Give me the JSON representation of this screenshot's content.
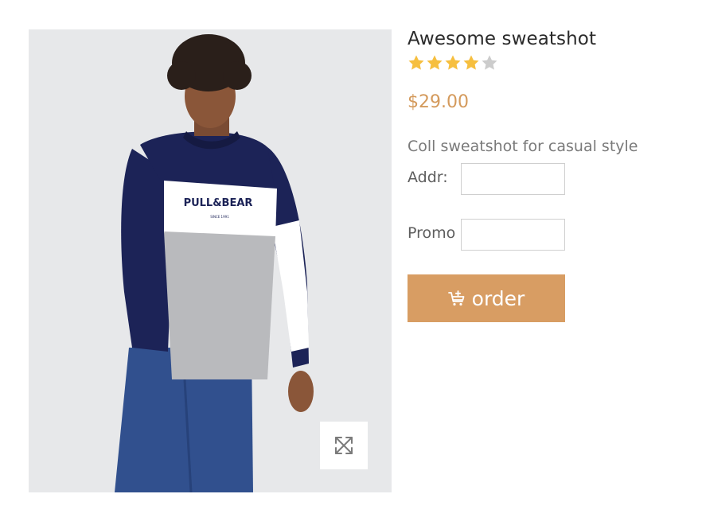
{
  "product": {
    "title": "Awesome sweatshot",
    "rating": {
      "value": 4,
      "max": 5
    },
    "price": "$29.00",
    "description": "Coll sweatshot for casual style",
    "image": {
      "logo_text": "PULL&BEAR",
      "logo_subtitle": "SINCE 1991"
    }
  },
  "form": {
    "addr_label": "Addr:",
    "addr_value": "",
    "promo_label": "Promo",
    "promo_value": ""
  },
  "order_button": {
    "label": "order",
    "icon": "cart-add-icon"
  },
  "zoom_button": {
    "icon": "expand-icon"
  },
  "colors": {
    "accent": "#d89d63",
    "price": "#d49a5c",
    "star_filled": "#f6bf3f",
    "star_empty": "#cccccc"
  }
}
